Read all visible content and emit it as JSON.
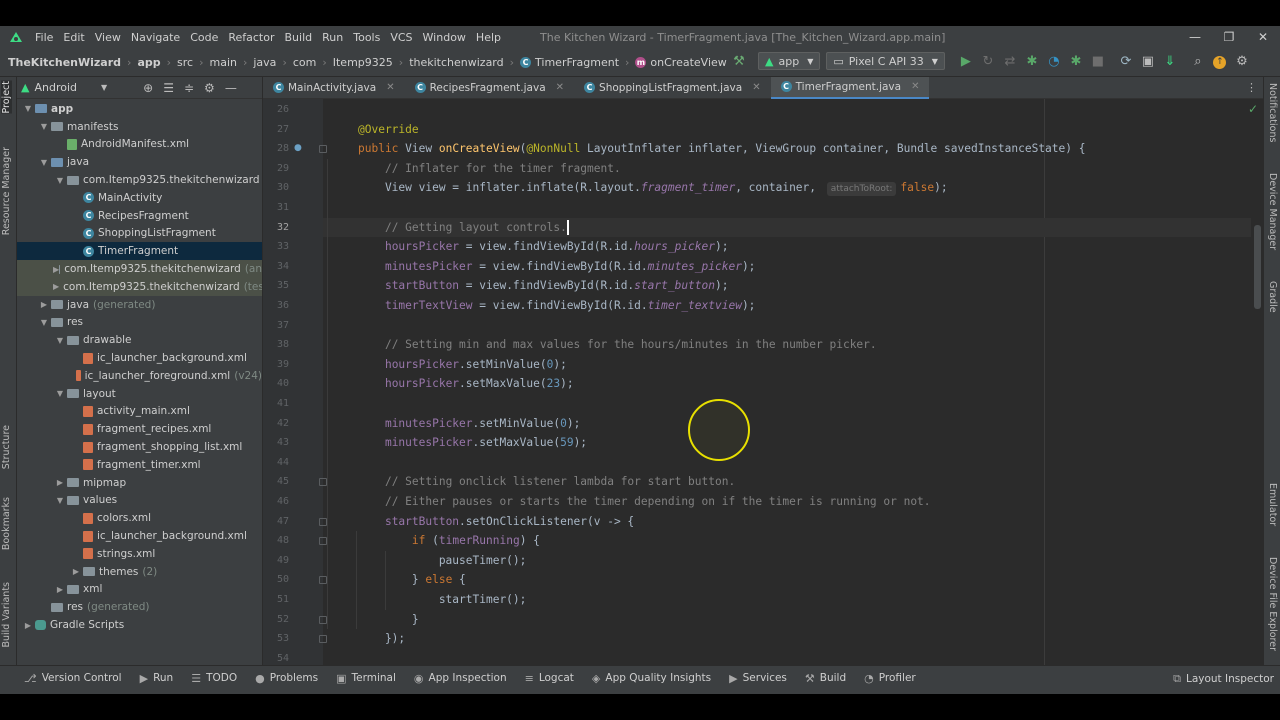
{
  "window": {
    "title": "The Kitchen Wizard - TimerFragment.java [The_Kitchen_Wizard.app.main]",
    "menu": [
      "File",
      "Edit",
      "View",
      "Navigate",
      "Code",
      "Refactor",
      "Build",
      "Run",
      "Tools",
      "VCS",
      "Window",
      "Help"
    ],
    "controls": {
      "minimize": "—",
      "restore": "❐",
      "close": "✕"
    }
  },
  "breadcrumb": {
    "items": [
      "TheKitchenWizard",
      "app",
      "src",
      "main",
      "java",
      "com",
      "Itemp9325",
      "thekitchenwizard"
    ],
    "class_item": "TimerFragment",
    "method_item": "onCreateView",
    "separator": "›"
  },
  "toolbar": {
    "run_config": "app",
    "device": "Pixel C API 33"
  },
  "project_panel": {
    "view_selector": "Android",
    "tree": [
      {
        "label": "app",
        "depth": 0,
        "arrow": "▼",
        "icon": "folder-blue",
        "bold": true
      },
      {
        "label": "manifests",
        "depth": 1,
        "arrow": "▼",
        "icon": "folder"
      },
      {
        "label": "AndroidManifest.xml",
        "depth": 2,
        "arrow": "",
        "icon": "manifest"
      },
      {
        "label": "java",
        "depth": 1,
        "arrow": "▼",
        "icon": "folder-blue"
      },
      {
        "label": "com.Itemp9325.thekitchenwizard",
        "depth": 2,
        "arrow": "▼",
        "icon": "package"
      },
      {
        "label": "MainActivity",
        "depth": 3,
        "arrow": "",
        "icon": "class"
      },
      {
        "label": "RecipesFragment",
        "depth": 3,
        "arrow": "",
        "icon": "class"
      },
      {
        "label": "ShoppingListFragment",
        "depth": 3,
        "arrow": "",
        "icon": "class"
      },
      {
        "label": "TimerFragment",
        "depth": 3,
        "arrow": "",
        "icon": "class",
        "selected": true
      },
      {
        "label": "com.Itemp9325.thekitchenwizard",
        "suffix": "(an",
        "depth": 2,
        "arrow": "▶",
        "icon": "package",
        "muted_bg": true
      },
      {
        "label": "com.Itemp9325.thekitchenwizard",
        "suffix": "(tes",
        "depth": 2,
        "arrow": "▶",
        "icon": "package",
        "muted_bg": true
      },
      {
        "label": "java",
        "suffix": "(generated)",
        "depth": 1,
        "arrow": "▶",
        "icon": "folder"
      },
      {
        "label": "res",
        "depth": 1,
        "arrow": "▼",
        "icon": "folder"
      },
      {
        "label": "drawable",
        "depth": 2,
        "arrow": "▼",
        "icon": "folder"
      },
      {
        "label": "ic_launcher_background.xml",
        "depth": 3,
        "arrow": "",
        "icon": "xml"
      },
      {
        "label": "ic_launcher_foreground.xml",
        "suffix": "(v24)",
        "depth": 3,
        "arrow": "",
        "icon": "xml"
      },
      {
        "label": "layout",
        "depth": 2,
        "arrow": "▼",
        "icon": "folder"
      },
      {
        "label": "activity_main.xml",
        "depth": 3,
        "arrow": "",
        "icon": "xml"
      },
      {
        "label": "fragment_recipes.xml",
        "depth": 3,
        "arrow": "",
        "icon": "xml"
      },
      {
        "label": "fragment_shopping_list.xml",
        "depth": 3,
        "arrow": "",
        "icon": "xml"
      },
      {
        "label": "fragment_timer.xml",
        "depth": 3,
        "arrow": "",
        "icon": "xml"
      },
      {
        "label": "mipmap",
        "depth": 2,
        "arrow": "▶",
        "icon": "folder"
      },
      {
        "label": "values",
        "depth": 2,
        "arrow": "▼",
        "icon": "folder"
      },
      {
        "label": "colors.xml",
        "depth": 3,
        "arrow": "",
        "icon": "xml"
      },
      {
        "label": "ic_launcher_background.xml",
        "depth": 3,
        "arrow": "",
        "icon": "xml"
      },
      {
        "label": "strings.xml",
        "depth": 3,
        "arrow": "",
        "icon": "xml"
      },
      {
        "label": "themes",
        "suffix": "(2)",
        "depth": 3,
        "arrow": "▶",
        "icon": "folder"
      },
      {
        "label": "xml",
        "depth": 2,
        "arrow": "▶",
        "icon": "folder"
      },
      {
        "label": "res",
        "suffix": "(generated)",
        "depth": 1,
        "arrow": "",
        "icon": "folder"
      },
      {
        "label": "Gradle Scripts",
        "depth": 0,
        "arrow": "▶",
        "icon": "gradle"
      }
    ]
  },
  "left_stripe": [
    "Project",
    "Resource Manager",
    "Structure",
    "Bookmarks",
    "Build Variants"
  ],
  "right_stripe": [
    "Notifications",
    "Device Manager",
    "Gradle",
    "Emulator",
    "Device File Explorer"
  ],
  "editor_tabs": [
    {
      "label": "MainActivity.java",
      "active": false
    },
    {
      "label": "RecipesFragment.java",
      "active": false
    },
    {
      "label": "ShoppingListFragment.java",
      "active": false
    },
    {
      "label": "TimerFragment.java",
      "active": true
    }
  ],
  "editor": {
    "current_line": 32,
    "line_numbers": [
      26,
      27,
      28,
      29,
      30,
      31,
      32,
      33,
      34,
      35,
      36,
      37,
      38,
      39,
      40,
      41,
      42,
      43,
      44,
      45,
      46,
      47,
      48,
      49,
      50,
      51,
      52,
      53,
      54
    ],
    "param_hint": "attachToRoot:",
    "lines": [
      [],
      [
        {
          "t": "@Override",
          "c": "ann"
        }
      ],
      [
        {
          "t": "public ",
          "c": "kw"
        },
        {
          "t": "View "
        },
        {
          "t": "onCreateView",
          "c": "fn"
        },
        {
          "t": "("
        },
        {
          "t": "@NonNull",
          "c": "ann"
        },
        {
          "t": " LayoutInflater inflater, ViewGroup container, Bundle savedInstanceState) {"
        }
      ],
      [
        {
          "t": "    "
        },
        {
          "t": "// Inflater for the timer fragment.",
          "c": "cm"
        }
      ],
      [
        {
          "t": "    View view = inflater.inflate(R.layout."
        },
        {
          "t": "fragment_timer",
          "c": "it"
        },
        {
          "t": ", container, "
        },
        {
          "hint": true
        },
        {
          "t": "false",
          "c": "kw"
        },
        {
          "t": ");"
        }
      ],
      [],
      [
        {
          "t": "    "
        },
        {
          "t": "// Getting layout controls.",
          "c": "cm"
        }
      ],
      [
        {
          "t": "    "
        },
        {
          "t": "hoursPicker",
          "c": "fld"
        },
        {
          "t": " = view.findViewById(R.id."
        },
        {
          "t": "hours_picker",
          "c": "it"
        },
        {
          "t": ");"
        }
      ],
      [
        {
          "t": "    "
        },
        {
          "t": "minutesPicker",
          "c": "fld"
        },
        {
          "t": " = view.findViewById(R.id."
        },
        {
          "t": "minutes_picker",
          "c": "it"
        },
        {
          "t": ");"
        }
      ],
      [
        {
          "t": "    "
        },
        {
          "t": "startButton",
          "c": "fld"
        },
        {
          "t": " = view.findViewById(R.id."
        },
        {
          "t": "start_button",
          "c": "it"
        },
        {
          "t": ");"
        }
      ],
      [
        {
          "t": "    "
        },
        {
          "t": "timerTextView",
          "c": "fld"
        },
        {
          "t": " = view.findViewById(R.id."
        },
        {
          "t": "timer_textview",
          "c": "it"
        },
        {
          "t": ");"
        }
      ],
      [],
      [
        {
          "t": "    "
        },
        {
          "t": "// Setting min and max values for the hours/minutes in the number picker.",
          "c": "cm"
        }
      ],
      [
        {
          "t": "    "
        },
        {
          "t": "hoursPicker",
          "c": "fld"
        },
        {
          "t": ".setMinValue("
        },
        {
          "t": "0",
          "c": "num"
        },
        {
          "t": ");"
        }
      ],
      [
        {
          "t": "    "
        },
        {
          "t": "hoursPicker",
          "c": "fld"
        },
        {
          "t": ".setMaxValue("
        },
        {
          "t": "23",
          "c": "num"
        },
        {
          "t": ");"
        }
      ],
      [],
      [
        {
          "t": "    "
        },
        {
          "t": "minutesPicker",
          "c": "fld"
        },
        {
          "t": ".setMinValue("
        },
        {
          "t": "0",
          "c": "num"
        },
        {
          "t": ");"
        }
      ],
      [
        {
          "t": "    "
        },
        {
          "t": "minutesPicker",
          "c": "fld"
        },
        {
          "t": ".setMaxValue("
        },
        {
          "t": "59",
          "c": "num"
        },
        {
          "t": ");"
        }
      ],
      [],
      [
        {
          "t": "    "
        },
        {
          "t": "// Setting onclick listener lambda for start button.",
          "c": "cm"
        }
      ],
      [
        {
          "t": "    "
        },
        {
          "t": "// Either pauses or starts the timer depending on if the timer is running or not.",
          "c": "cm"
        }
      ],
      [
        {
          "t": "    "
        },
        {
          "t": "startButton",
          "c": "fld"
        },
        {
          "t": ".setOnClickListener(v -> {"
        }
      ],
      [
        {
          "t": "        "
        },
        {
          "t": "if ",
          "c": "kw"
        },
        {
          "t": "("
        },
        {
          "t": "timerRunning",
          "c": "fld"
        },
        {
          "t": ") {"
        }
      ],
      [
        {
          "t": "            pauseTimer();"
        }
      ],
      [
        {
          "t": "        } "
        },
        {
          "t": "else ",
          "c": "kw"
        },
        {
          "t": "{"
        }
      ],
      [
        {
          "t": "            startTimer();"
        }
      ],
      [
        {
          "t": "        }"
        }
      ],
      [
        {
          "t": "    });"
        }
      ],
      []
    ]
  },
  "bottom_tools": [
    {
      "icon": "git-icon",
      "glyph": "⎇",
      "label": "Version Control"
    },
    {
      "icon": "run-icon",
      "glyph": "▶",
      "label": "Run"
    },
    {
      "icon": "todo-icon",
      "glyph": "☰",
      "label": "TODO"
    },
    {
      "icon": "problems-icon",
      "glyph": "●",
      "label": "Problems"
    },
    {
      "icon": "terminal-icon",
      "glyph": "▣",
      "label": "Terminal"
    },
    {
      "icon": "app-inspection-icon",
      "glyph": "◉",
      "label": "App Inspection"
    },
    {
      "icon": "logcat-icon",
      "glyph": "≡",
      "label": "Logcat"
    },
    {
      "icon": "app-quality-icon",
      "glyph": "◈",
      "label": "App Quality Insights"
    },
    {
      "icon": "services-icon",
      "glyph": "▶",
      "label": "Services"
    },
    {
      "icon": "build-icon",
      "glyph": "⚒",
      "label": "Build"
    },
    {
      "icon": "profiler-icon",
      "glyph": "◔",
      "label": "Profiler"
    }
  ],
  "layout_inspector": {
    "icon": "layout-inspector-icon",
    "label": "Layout Inspector"
  }
}
